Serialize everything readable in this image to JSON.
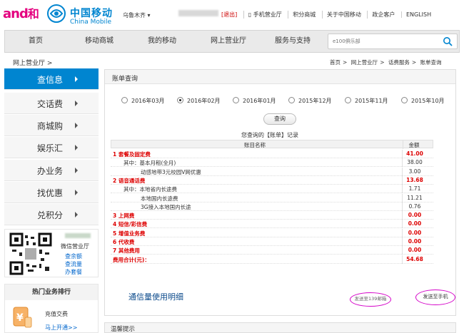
{
  "header": {
    "and_logo": "and",
    "and_logo_cn": "和",
    "brand_cn": "中国移动",
    "brand_en": "China Mobile",
    "city": "乌鲁木齐",
    "logout": "[退出]",
    "links": [
      "手机营业厅",
      "积分商城",
      "关于中国移动",
      "政企客户",
      "ENGLISH"
    ]
  },
  "nav": {
    "items": [
      "首页",
      "移动商城",
      "我的移动",
      "网上营业厅",
      "服务与支持"
    ],
    "search_placeholder": "e100俱乐部"
  },
  "breadcrumb": {
    "left": "网上营业厅 >",
    "right": [
      "首页",
      ">",
      "网上营业厅",
      ">",
      "话费服务",
      ">",
      "账单查询"
    ]
  },
  "sidebar": {
    "items": [
      "查信息",
      "交话费",
      "商城购",
      "娱乐汇",
      "办业务",
      "找优惠",
      "兑积分"
    ],
    "active_index": 0,
    "wechat": {
      "title": "微信营业厅",
      "links": [
        "查余额",
        "查流量",
        "办套餐"
      ]
    },
    "hot": {
      "title": "热门业务排行",
      "item": "充值交费",
      "link": "马上开通>>"
    }
  },
  "panel": {
    "title": "账单查询",
    "months": [
      "2016年03月",
      "2016年02月",
      "2016年01月",
      "2015年12月",
      "2015年11月",
      "2015年10月"
    ],
    "selected_month_index": 1,
    "query_button": "查询",
    "record_title": "您查询的【账单】记录",
    "table_header": {
      "name": "账目名称",
      "amount": "金额"
    },
    "rows": [
      {
        "name": "1 套餐及固定费",
        "amount": "41.00",
        "level": 0
      },
      {
        "name": "其中：基本月租(全月)",
        "amount": "38.00",
        "level": 1
      },
      {
        "name": "动感地带3元校园V网优惠",
        "amount": "3.00",
        "level": 2
      },
      {
        "name": "2 语音通话费",
        "amount": "13.68",
        "level": 0
      },
      {
        "name": "其中：本地省内长途费",
        "amount": "1.71",
        "level": 1
      },
      {
        "name": "本地国内长途费",
        "amount": "11.21",
        "level": 2
      },
      {
        "name": "3G接入本地国内长途",
        "amount": "0.76",
        "level": 2
      },
      {
        "name": "3 上网费",
        "amount": "0.00",
        "level": 0
      },
      {
        "name": "4 短信/彩信费",
        "amount": "0.00",
        "level": 0
      },
      {
        "name": "5 增值业务费",
        "amount": "0.00",
        "level": 0
      },
      {
        "name": "6 代收费",
        "amount": "0.00",
        "level": 0
      },
      {
        "name": "7 其他费用",
        "amount": "0.00",
        "level": 0
      },
      {
        "name": "费用合计(元)：",
        "amount": "54.68",
        "level": 0
      }
    ],
    "usage_title": "通信量使用明细",
    "action_left": "发送至139邮箱",
    "action_right": "发送至手机",
    "tips_title": "温馨提示"
  },
  "colors": {
    "accent_blue": "#0085d0",
    "highlight_red": "#d00000",
    "annotation_magenta": "#d400c8"
  }
}
